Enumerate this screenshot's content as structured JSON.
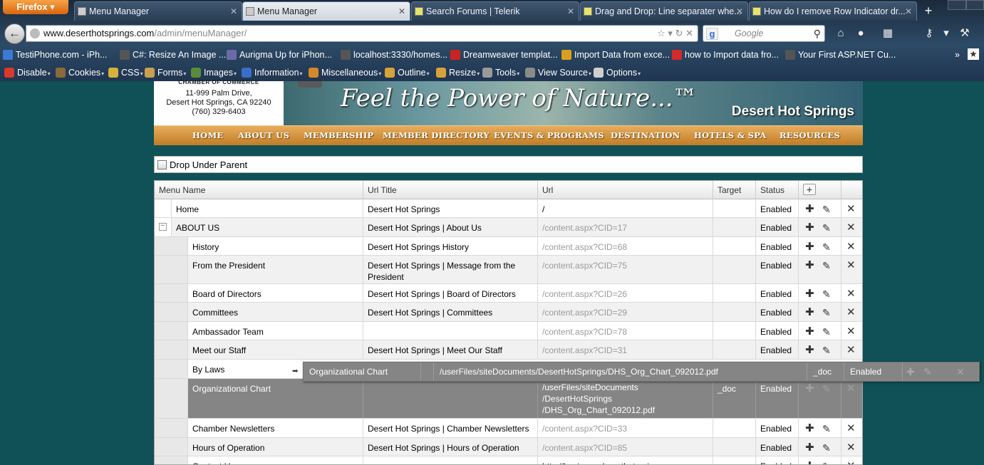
{
  "browser": {
    "firefox_label": "Firefox ▾",
    "tabs": [
      {
        "label": "Menu Manager",
        "active": false
      },
      {
        "label": "Menu Manager",
        "active": true
      },
      {
        "label": "Search Forums | Telerik",
        "active": false
      },
      {
        "label": "Drag and Drop: Line separater whe...",
        "active": false
      },
      {
        "label": "How do I remove Row Indicator dr...",
        "active": false
      }
    ],
    "url_host": "www.deserthotsprings.com",
    "url_path": "/admin/menuManager/",
    "url_prefix": "",
    "search_placeholder": "Google",
    "bookmarks": [
      {
        "label": "TestiPhone.com - iPh...",
        "color": "#3a7bd5"
      },
      {
        "label": "C#: Resize An Image ...",
        "color": "#555555"
      },
      {
        "label": "Aurigma Up for iPhon...",
        "color": "#6a6aa8"
      },
      {
        "label": "localhost:3330/homes...",
        "color": "#555555"
      },
      {
        "label": "Dreamweaver templat...",
        "color": "#cc2222"
      },
      {
        "label": "Import Data from exce...",
        "color": "#d9a020"
      },
      {
        "label": "how to Import data fro...",
        "color": "#d42a2a"
      },
      {
        "label": "Your First ASP.NET Cu...",
        "color": "#555555"
      }
    ],
    "webdev_toolbar": [
      {
        "label": "Disable",
        "color": "#d93a2b"
      },
      {
        "label": "Cookies",
        "color": "#8a6a3a"
      },
      {
        "label": "CSS",
        "color": "#d6b23a"
      },
      {
        "label": "Forms",
        "color": "#c9a050"
      },
      {
        "label": "Images",
        "color": "#5b8a3a"
      },
      {
        "label": "Information",
        "color": "#3a6fc9"
      },
      {
        "label": "Miscellaneous",
        "color": "#d4882a"
      },
      {
        "label": "Outline",
        "color": "#d6a23a"
      },
      {
        "label": "Resize",
        "color": "#d6a23a"
      },
      {
        "label": "Tools",
        "color": "#9a9a9a"
      },
      {
        "label": "View Source",
        "color": "#8a8a8a"
      },
      {
        "label": "Options",
        "color": "#cfcfcf"
      }
    ]
  },
  "site": {
    "chamber_heading": "CHAMBER OF COMMERCE",
    "address_line1": "11-999 Palm Drive,",
    "address_line2": "Desert Hot Springs, CA 92240",
    "phone": "(760) 329-6403",
    "tagline": "Feel the Power of Nature...™",
    "city_name": "Desert Hot Springs",
    "nav": [
      "HOME",
      "ABOUT US",
      "MEMBERSHIP",
      "MEMBER DIRECTORY",
      "EVENTS & PROGRAMS",
      "DESTINATION",
      "HOTELS & SPA",
      "RESOURCES"
    ]
  },
  "drop_under_parent_label": "Drop Under Parent",
  "grid": {
    "headers": {
      "menu_name": "Menu Name",
      "url_title": "Url Title",
      "url": "Url",
      "target": "Target",
      "status": "Status"
    },
    "rows": [
      {
        "name": "Home",
        "title": "Desert Hot Springs",
        "url": "/",
        "target": "",
        "status": "Enabled"
      },
      {
        "name": "ABOUT US",
        "title": "Desert Hot Springs | About Us",
        "url": "/content.aspx?CID=17",
        "target": "",
        "status": "Enabled"
      },
      {
        "name": "History",
        "title": "Desert Hot Springs History",
        "url": "/content.aspx?CID=68",
        "target": "",
        "status": "Enabled"
      },
      {
        "name": "From the President",
        "title": "Desert Hot Springs | Message from the President",
        "url": "/content.aspx?CID=75",
        "target": "",
        "status": "Enabled"
      },
      {
        "name": "Board of Directors",
        "title": "Desert Hot Springs | Board of Directors",
        "url": "/content.aspx?CID=26",
        "target": "",
        "status": "Enabled"
      },
      {
        "name": "Committees",
        "title": "Desert Hot Springs | Committees",
        "url": "/content.aspx?CID=29",
        "target": "",
        "status": "Enabled"
      },
      {
        "name": "Ambassador Team",
        "title": "",
        "url": "/content.aspx?CID=78",
        "target": "",
        "status": "Enabled"
      },
      {
        "name": "Meet our Staff",
        "title": "Desert Hot Springs | Meet Our Staff",
        "url": "/content.aspx?CID=31",
        "target": "",
        "status": "Enabled"
      },
      {
        "name": "By Laws",
        "title": "",
        "url": "",
        "target": "",
        "status": ""
      },
      {
        "name": "Organizational Chart",
        "title": "",
        "url_lines": [
          "/userFiles/siteDocuments",
          "/DesertHotSprings",
          "/DHS_Org_Chart_092012.pdf"
        ],
        "target": "_doc",
        "status": "Enabled"
      },
      {
        "name": "Chamber Newsletters",
        "title": "Desert Hot Springs | Chamber Newsletters",
        "url": "/content.aspx?CID=33",
        "target": "",
        "status": "Enabled"
      },
      {
        "name": "Hours of Operation",
        "title": "Desert Hot Springs | Hours of Operation",
        "url": "/content.aspx?CID=85",
        "target": "",
        "status": "Enabled"
      },
      {
        "name": "Contact Us",
        "title": "",
        "url": "http://business.deserthotsprings.com",
        "target": "",
        "status": "Enabled"
      }
    ]
  },
  "drag_clue": {
    "name": "Organizational Chart",
    "url": "/userFiles/siteDocuments/DesertHotSprings/DHS_Org_Chart_092012.pdf",
    "target": "_doc",
    "status": "Enabled"
  }
}
